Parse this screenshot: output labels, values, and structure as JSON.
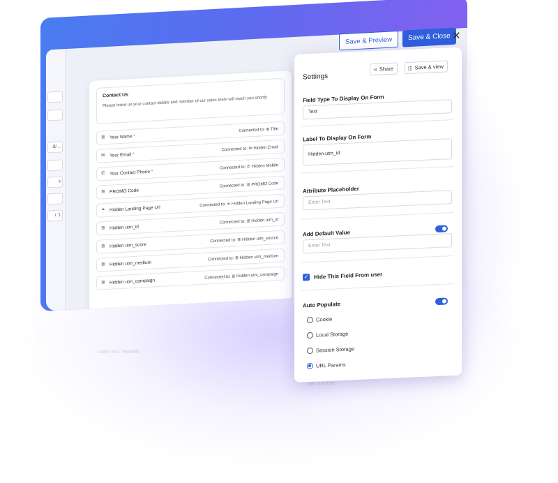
{
  "toolbar": {
    "save_preview": "Save & Preview",
    "save_close": "Save & Close",
    "close": "✕"
  },
  "left_stubs": [
    "d/...",
    "s",
    "r 1"
  ],
  "form": {
    "title": "Contact Us",
    "subtitle": "Please leave us your contact details and member of our sales team will reach you shortly",
    "connected_prefix": "Connected to:",
    "rows": [
      {
        "icon": "≣",
        "label": "Your Name",
        "required": "*",
        "target_icon": "≣",
        "target": "Title"
      },
      {
        "icon": "✉",
        "label": "Your Email",
        "required": "*",
        "target_icon": "✉",
        "target": "Hidden Email"
      },
      {
        "icon": "✆",
        "label": "Your Contact Phone",
        "required": "*",
        "target_icon": "✆",
        "target": "Hidden Mobile"
      },
      {
        "icon": "≣",
        "label": "PROMO Code",
        "required": "",
        "target_icon": "≣",
        "target": "PROMO Code"
      },
      {
        "icon": "⚭",
        "label": "Hidden Landing Page Url",
        "required": "",
        "target_icon": "⚭",
        "target": "Hidden Landing Page Url"
      },
      {
        "icon": "≣",
        "label": "Hidden utm_id",
        "required": "",
        "target_icon": "≣",
        "target": "Hidden utm_id"
      },
      {
        "icon": "≣",
        "label": "Hidden utm_score",
        "required": "",
        "target_icon": "≣",
        "target": "Hidden utm_source"
      },
      {
        "icon": "≣",
        "label": "Hidden utm_medium",
        "required": "",
        "target_icon": "≣",
        "target": "Hidden utm_medium"
      },
      {
        "icon": "≣",
        "label": "Hidden utm_campaign",
        "required": "",
        "target_icon": "≣",
        "target": "Hidden utm_campaign"
      }
    ]
  },
  "settings": {
    "title": "Settings",
    "share": "Share",
    "save_view": "Save & view",
    "field_type_label": "Field Type To Display On Form",
    "field_type_value": "Text",
    "label_label": "Label To Display On Form",
    "label_value": "Hidden utm_id",
    "placeholder_label": "Attribute Placeholder",
    "placeholder_ph": "Enter Text",
    "default_label": "Add Default Value",
    "default_ph": "Enter Text",
    "hide_label": "Hide This Field From user",
    "auto_label": "Auto Populate",
    "options": [
      {
        "label": "Cookie",
        "selected": false
      },
      {
        "label": "Local Storage",
        "selected": false
      },
      {
        "label": "Session Storage",
        "selected": false
      },
      {
        "label": "URL Params",
        "selected": true
      }
    ]
  },
  "reflection": {
    "row_text": "Hidden utm_campaign",
    "option_text": "URL Params"
  }
}
